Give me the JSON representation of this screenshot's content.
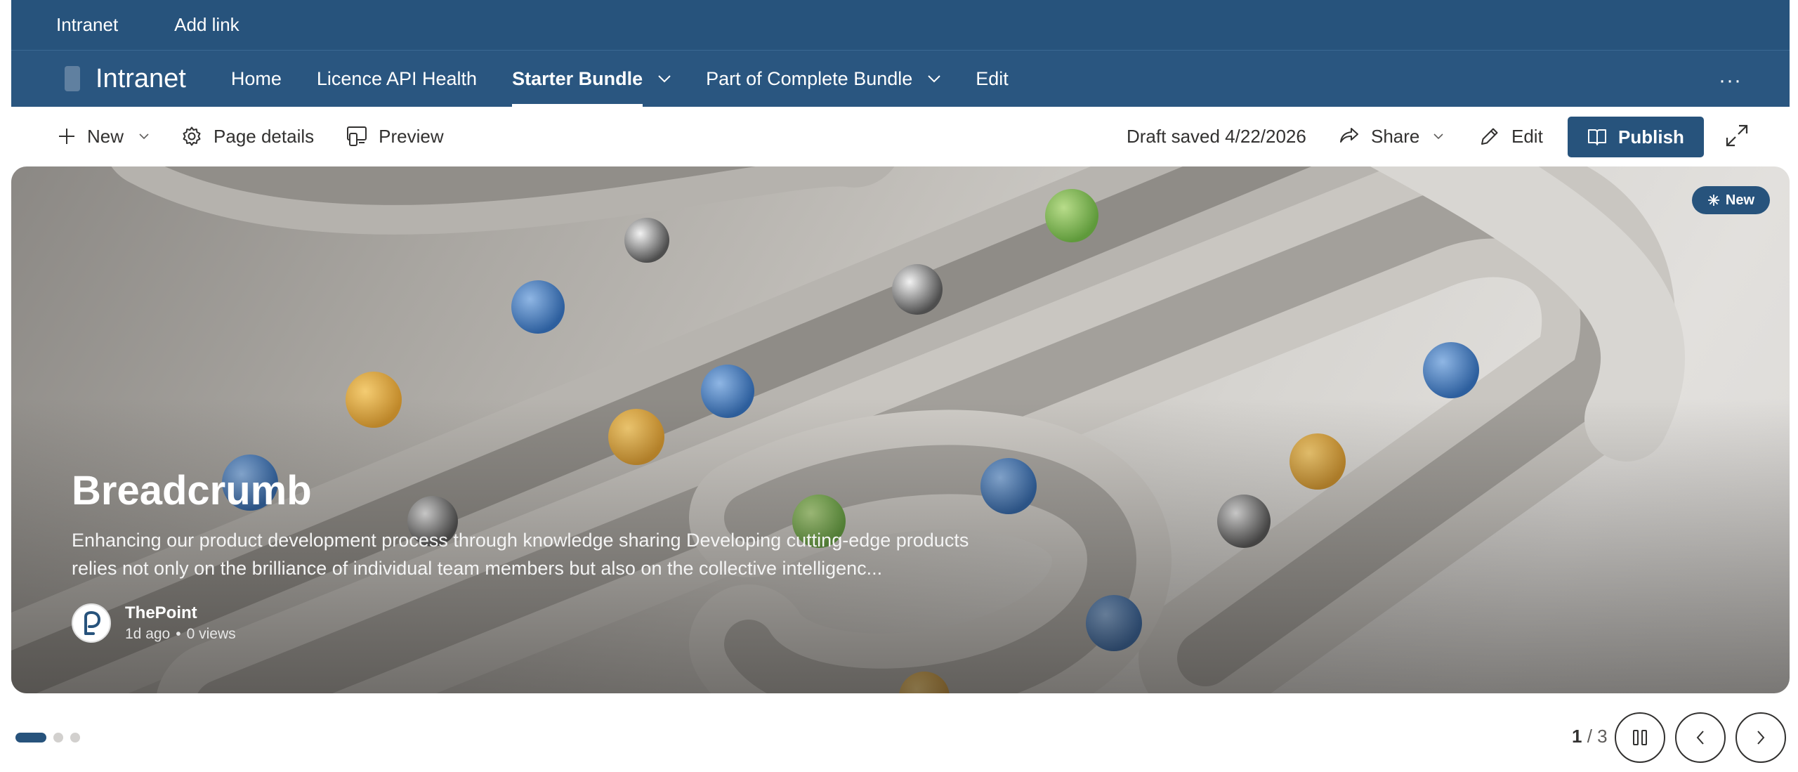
{
  "suite_bar": {
    "home_label": "Intranet",
    "add_link_label": "Add link"
  },
  "site_header": {
    "title": "Intranet",
    "nav": [
      {
        "label": "Home"
      },
      {
        "label": "Licence API Health"
      },
      {
        "label": "Starter Bundle"
      },
      {
        "label": "Part of Complete Bundle"
      },
      {
        "label": "Edit"
      }
    ],
    "more_label": "···"
  },
  "command_bar": {
    "new_label": "New",
    "page_details_label": "Page details",
    "preview_label": "Preview",
    "draft_status": "Draft saved 4/22/2026",
    "share_label": "Share",
    "edit_label": "Edit",
    "publish_label": "Publish"
  },
  "hero": {
    "badge_label": "New",
    "title": "Breadcrumb",
    "description": "Enhancing our product development process through knowledge sharing Developing cutting-edge products relies not only on the brilliance of individual team members but also on the collective intelligenc...",
    "author_name": "ThePoint",
    "age": "1d ago",
    "views": "0 views"
  },
  "carousel": {
    "current": "1",
    "total": "/ 3",
    "slide_count": 3,
    "active_index": 0
  },
  "colors": {
    "brand": "#27537c",
    "white": "#ffffff"
  }
}
